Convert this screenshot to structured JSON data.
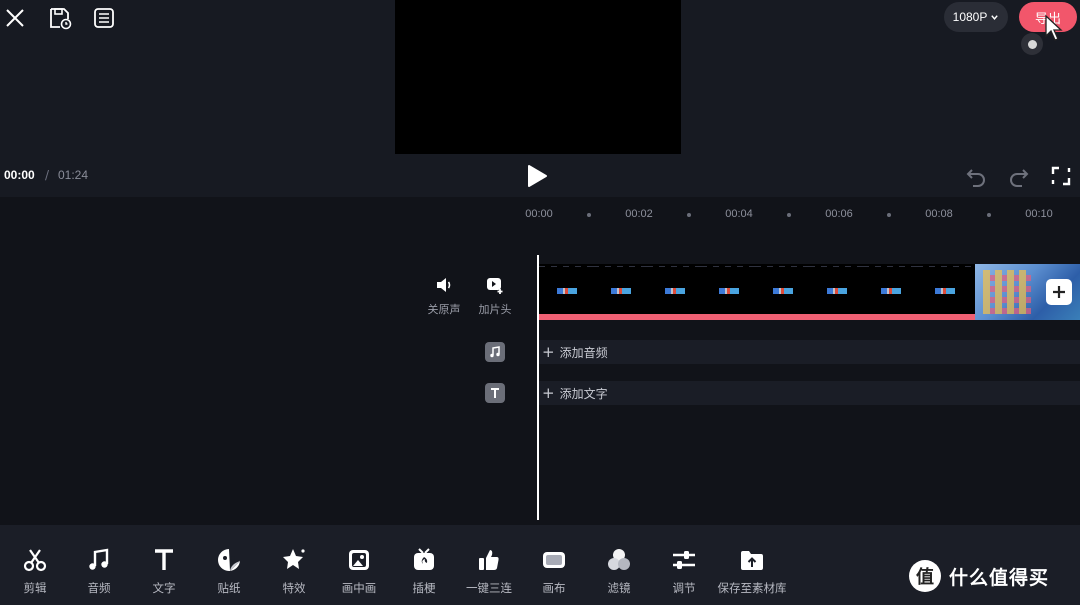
{
  "header": {
    "resolution": "1080P",
    "export_label": "导出"
  },
  "icons": {
    "close": "close-icon",
    "save_draft": "save-draft-icon",
    "list": "list-icon",
    "play": "play-icon",
    "undo": "undo-icon",
    "redo": "redo-icon",
    "fullscreen": "fullscreen-icon"
  },
  "playback": {
    "current_time": "00:00",
    "separator": "/",
    "total_time": "01:24"
  },
  "ruler": [
    "00:00",
    "00:02",
    "00:04",
    "00:06",
    "00:08",
    "00:10"
  ],
  "side_tools": [
    {
      "label": "关原声",
      "icon": "speaker-icon"
    },
    {
      "label": "加片头",
      "icon": "add-intro-icon"
    }
  ],
  "tracks": {
    "audio_label": "添加音频",
    "text_label": "添加文字"
  },
  "toolbar": [
    {
      "label": "剪辑",
      "icon": "scissors-icon"
    },
    {
      "label": "音频",
      "icon": "music-icon"
    },
    {
      "label": "文字",
      "icon": "text-icon"
    },
    {
      "label": "贴纸",
      "icon": "sticker-icon"
    },
    {
      "label": "特效",
      "icon": "effects-icon"
    },
    {
      "label": "画中画",
      "icon": "picture-in-picture-icon"
    },
    {
      "label": "插梗",
      "icon": "meme-tv-icon"
    },
    {
      "label": "一键三连",
      "icon": "thumbs-up-icon"
    },
    {
      "label": "画布",
      "icon": "canvas-icon"
    },
    {
      "label": "滤镜",
      "icon": "filter-icon"
    },
    {
      "label": "调节",
      "icon": "adjust-icon"
    },
    {
      "label": "保存至素材库",
      "icon": "save-to-library-icon"
    }
  ],
  "watermark": {
    "logo_char": "值",
    "text": "什么值得买"
  },
  "colors": {
    "accent": "#f2566b",
    "background": "#14171f",
    "track_strip": "#f06073"
  }
}
